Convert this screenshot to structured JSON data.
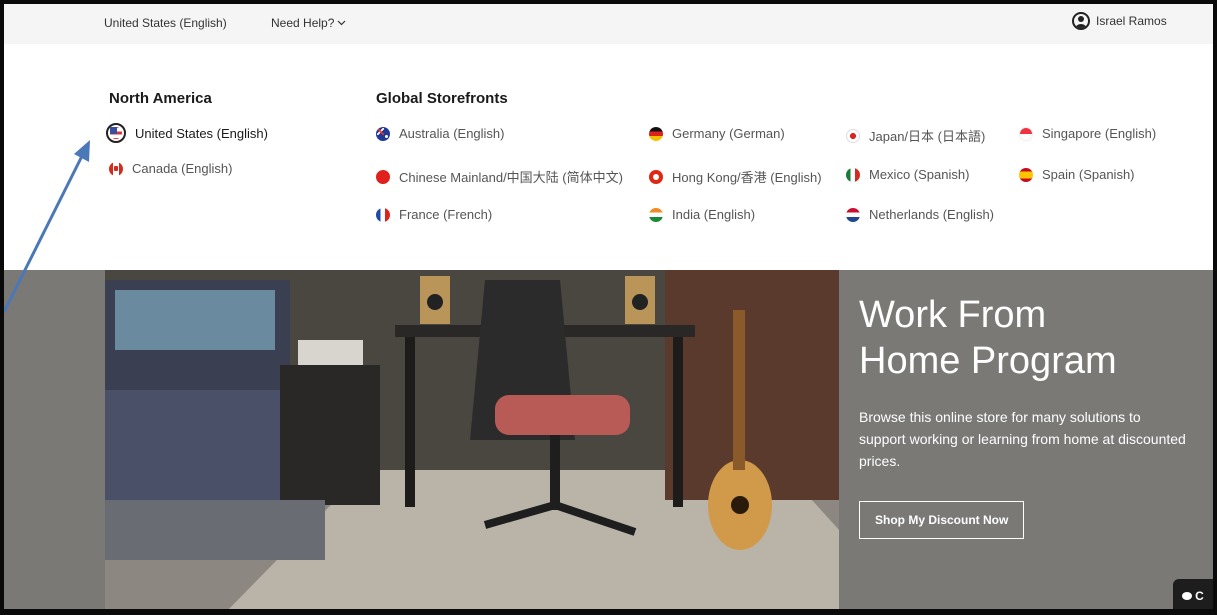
{
  "topbar": {
    "locale": "United States (English)",
    "help": "Need Help?",
    "user_name": "Israel Ramos"
  },
  "panel": {
    "north_america": {
      "heading": "North America",
      "items": [
        {
          "label": "United States (English)",
          "flag": "us-flag-icon",
          "selected": true
        },
        {
          "label": "Canada (English)",
          "flag": "canada-flag-icon"
        }
      ]
    },
    "global": {
      "heading": "Global Storefronts",
      "items": [
        {
          "label": "Australia (English)",
          "flag": "australia-flag-icon"
        },
        {
          "label": "Chinese Mainland/中国大陆 (简体中文)",
          "flag": "china-flag-icon"
        },
        {
          "label": "France (French)",
          "flag": "france-flag-icon"
        },
        {
          "label": "Germany (German)",
          "flag": "germany-flag-icon"
        },
        {
          "label": "Hong Kong/香港 (English)",
          "flag": "hong-kong-flag-icon"
        },
        {
          "label": "India (English)",
          "flag": "india-flag-icon"
        },
        {
          "label": "Japan/日本 (日本語)",
          "flag": "japan-flag-icon"
        },
        {
          "label": "Mexico (Spanish)",
          "flag": "mexico-flag-icon"
        },
        {
          "label": "Netherlands (English)",
          "flag": "netherlands-flag-icon"
        },
        {
          "label": "Singapore (English)",
          "flag": "singapore-flag-icon"
        },
        {
          "label": "Spain (Spanish)",
          "flag": "spain-flag-icon"
        }
      ]
    }
  },
  "hero": {
    "title_line1": "Work From",
    "title_line2": "Home Program",
    "description": "Browse this online store for many solutions to support working or learning from home at discounted prices.",
    "button": "Shop My Discount Now",
    "chat_label": "C"
  },
  "colors": {
    "annotation_arrow": "#4a78b8",
    "hero_background": "#7a7976"
  }
}
